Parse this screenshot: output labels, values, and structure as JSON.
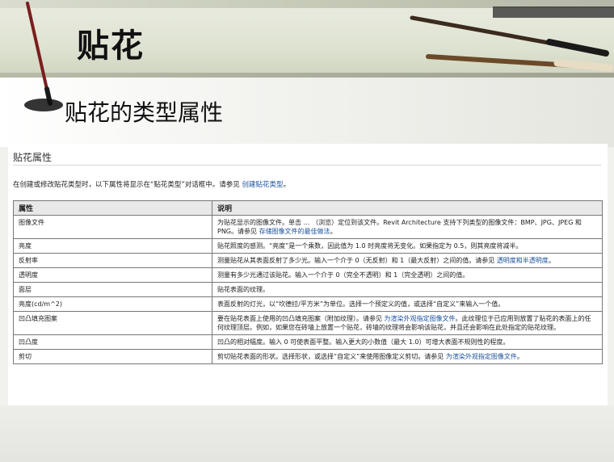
{
  "header": {
    "title": "贴花",
    "subtitle": "贴花的类型属性"
  },
  "content": {
    "section_title": "贴花属性",
    "intro_text": "在创建或修改贴花类型时，以下属性将显示在“贴花类型”对话框中。请参见",
    "intro_link": "创建贴花类型",
    "intro_end": "。"
  },
  "table": {
    "headers": [
      "属性",
      "说明"
    ],
    "rows": [
      {
        "name": "图像文件",
        "desc": "为贴花显示的图像文件。单击 … （浏览）定位到该文件。Revit Architecture 支持下列类型的图像文件：BMP、JPG、JPEG 和 PNG。请参见",
        "link": "存储图像文件的最佳做法",
        "tail": "。"
      },
      {
        "name": "亮度",
        "desc": "贴花照度的感测。“亮度”是一个乘数，因此值为 1.0 时亮度将无变化。如果指定为 0.5，则其亮度将减半。",
        "link": "",
        "tail": ""
      },
      {
        "name": "反射率",
        "desc": "测量贴花从其表面反射了多少光。输入一个介于 0（无反射）和 1（最大反射）之间的值。请参见",
        "link": "透明度和半透明度",
        "tail": "。"
      },
      {
        "name": "透明度",
        "desc": "测量有多少光通过该贴花。输入一个介于 0（完全不透明）和 1（完全透明）之间的值。",
        "link": "",
        "tail": ""
      },
      {
        "name": "面层",
        "desc": "贴花表面的纹理。",
        "link": "",
        "tail": ""
      },
      {
        "name": "亮度(cd/m^2)",
        "desc": "表面反射的灯光，以“坎德拉/平方米”为单位。选择一个预定义的值，或选择“自定义”来输入一个值。",
        "link": "",
        "tail": ""
      },
      {
        "name": "凹凸填充图案",
        "desc": "要在贴花表面上使用的凹凸填充图案（附加纹理）。请参见",
        "link": "为渲染外观指定图像文件",
        "tail": "。此纹理位于已应用到放置了贴花的表面上的任何纹理顶层。例如，如果您在砖墙上放置一个贴花，砖墙的纹理将会影响该贴花，并且还会影响在此处指定的贴花纹理。"
      },
      {
        "name": "凹凸度",
        "desc": "凹凸的相对幅度。输入 0 可使表面平整。输入更大的小数值（最大 1.0）可增大表面不规则性的程度。",
        "link": "",
        "tail": ""
      },
      {
        "name": "剪切",
        "desc": "剪切贴花表面的形状。选择形状，或选择“自定义”来使用图像定义剪切。请参见",
        "link": "为渲染外观指定图像文件",
        "tail": "。"
      }
    ]
  }
}
